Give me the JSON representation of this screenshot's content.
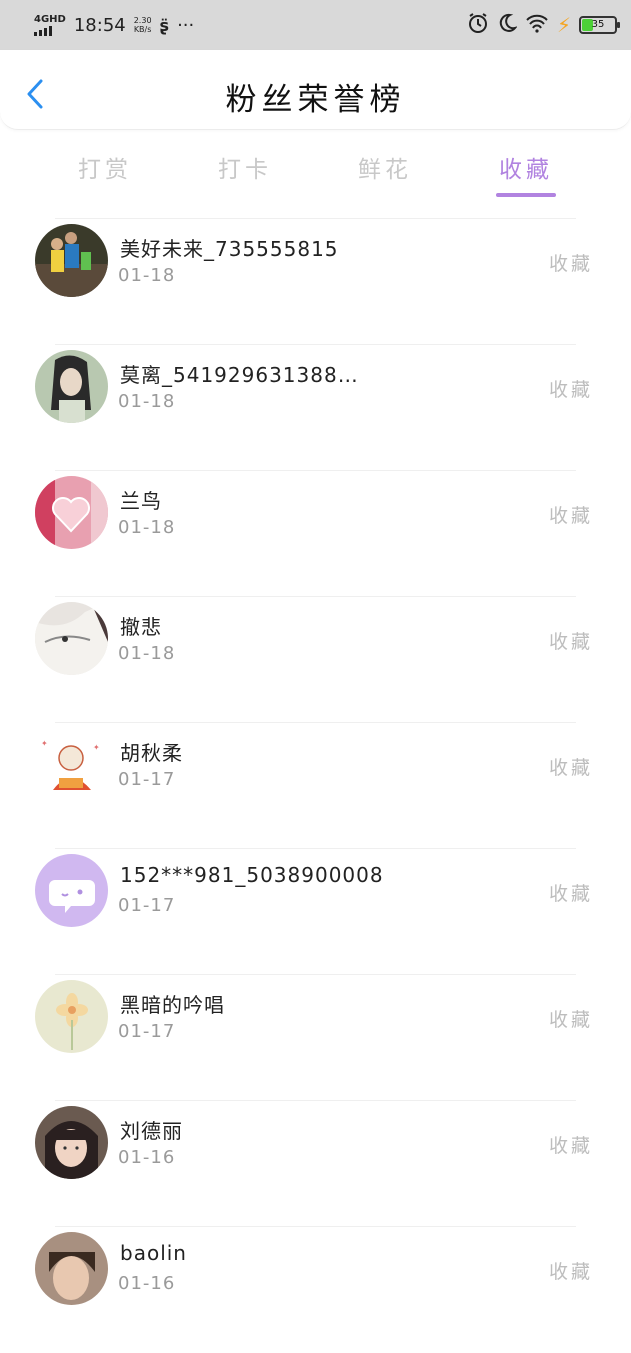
{
  "status_bar": {
    "network": "4GHD",
    "time": "18:54",
    "speed_value": "2.30",
    "speed_unit": "KB/s",
    "more": "···",
    "battery": "35",
    "battery_color": "#4cd137"
  },
  "nav": {
    "title": "粉丝荣誉榜"
  },
  "tabs": [
    {
      "label": "打赏"
    },
    {
      "label": "打卡"
    },
    {
      "label": "鲜花"
    },
    {
      "label": "收藏"
    }
  ],
  "active_tab_color": "#b183e0",
  "list": [
    {
      "name": "美好未来_735555815",
      "date": "01-18",
      "action": "收藏"
    },
    {
      "name": "莫离_541929631388…",
      "date": "01-18",
      "action": "收藏"
    },
    {
      "name": "兰鸟",
      "date": "01-18",
      "action": "收藏"
    },
    {
      "name": "撤悲",
      "date": "01-18",
      "action": "收藏"
    },
    {
      "name": "胡秋柔",
      "date": "01-17",
      "action": "收藏"
    },
    {
      "name": "152***981_5038900008",
      "date": "01-17",
      "action": "收藏"
    },
    {
      "name": "黑暗的吟唱",
      "date": "01-17",
      "action": "收藏"
    },
    {
      "name": "刘德丽",
      "date": "01-16",
      "action": "收藏"
    },
    {
      "name": "baolin",
      "date": "01-16",
      "action": "收藏"
    }
  ]
}
